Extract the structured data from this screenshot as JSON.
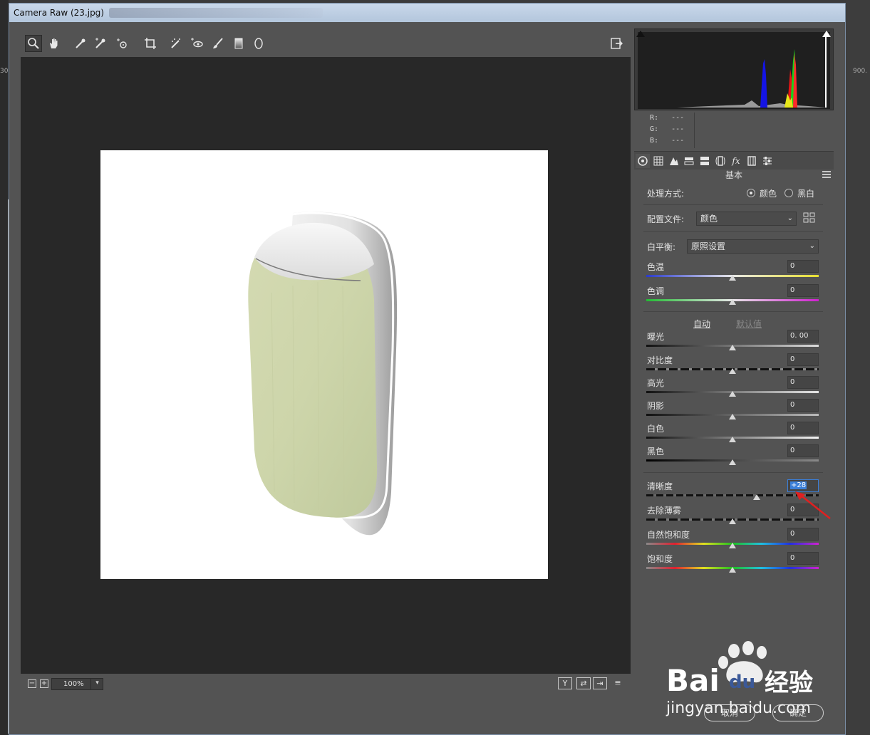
{
  "window": {
    "title": "Camera Raw (23.jpg)"
  },
  "workspace": {
    "ruler_right": "900.",
    "ruler_left": "30"
  },
  "toolbar": {
    "tools": [
      {
        "name": "zoom-icon",
        "active": true
      },
      {
        "name": "hand-icon"
      },
      {
        "name": "white-balance-eyedropper-icon"
      },
      {
        "name": "color-sampler-icon"
      },
      {
        "name": "targeted-adjustment-icon"
      },
      {
        "name": "crop-icon"
      },
      {
        "name": "spot-removal-icon"
      },
      {
        "name": "red-eye-icon"
      },
      {
        "name": "adjustment-brush-icon"
      },
      {
        "name": "graduated-filter-icon"
      },
      {
        "name": "radial-filter-icon"
      }
    ],
    "export_icon": "open-preferences-icon"
  },
  "preview": {
    "zoom_value": "100%",
    "zoom_out": "−",
    "zoom_in": "+",
    "view_buttons": [
      "Y",
      "⇄",
      "⇥",
      "≡"
    ]
  },
  "readout": {
    "r_label": "R:",
    "g_label": "G:",
    "b_label": "B:",
    "r_value": "---",
    "g_value": "---",
    "b_value": "---"
  },
  "panel": {
    "title": "基本",
    "process_label": "处理方式:",
    "process_color": "颜色",
    "process_bw": "黑白",
    "profile_label": "配置文件:",
    "profile_value": "颜色",
    "wb_label": "白平衡:",
    "wb_value": "原照设置",
    "auto": "自动",
    "default": "默认值"
  },
  "sliders": [
    {
      "key": "temp",
      "label": "色温",
      "value": "0",
      "pos": 0.5
    },
    {
      "key": "tint",
      "label": "色调",
      "value": "0",
      "pos": 0.5
    },
    {
      "key": "exposure",
      "label": "曝光",
      "value": "0. 00",
      "pos": 0.5
    },
    {
      "key": "contrast",
      "label": "对比度",
      "value": "0",
      "pos": 0.5
    },
    {
      "key": "highlights",
      "label": "高光",
      "value": "0",
      "pos": 0.5
    },
    {
      "key": "shadows",
      "label": "阴影",
      "value": "0",
      "pos": 0.5
    },
    {
      "key": "whites",
      "label": "白色",
      "value": "0",
      "pos": 0.5
    },
    {
      "key": "blacks",
      "label": "黑色",
      "value": "0",
      "pos": 0.5
    },
    {
      "key": "clarity",
      "label": "清晰度",
      "value": "+28",
      "pos": 0.64
    },
    {
      "key": "dehaze",
      "label": "去除薄雾",
      "value": "0",
      "pos": 0.5
    },
    {
      "key": "vibrance",
      "label": "自然饱和度",
      "value": "0",
      "pos": 0.5
    },
    {
      "key": "saturation",
      "label": "饱和度",
      "value": "0",
      "pos": 0.5
    }
  ],
  "footer": {
    "cancel": "取消",
    "ok": "确定"
  },
  "watermark": {
    "brand": "Bai du 经验",
    "url": "jingyan.baidu.com"
  },
  "colors": {
    "dialog_bg": "#535353",
    "preview_bg": "#282828",
    "accent": "#3b7fd8",
    "product_green": "#cdd5aa",
    "arrow_red": "#e02020"
  }
}
